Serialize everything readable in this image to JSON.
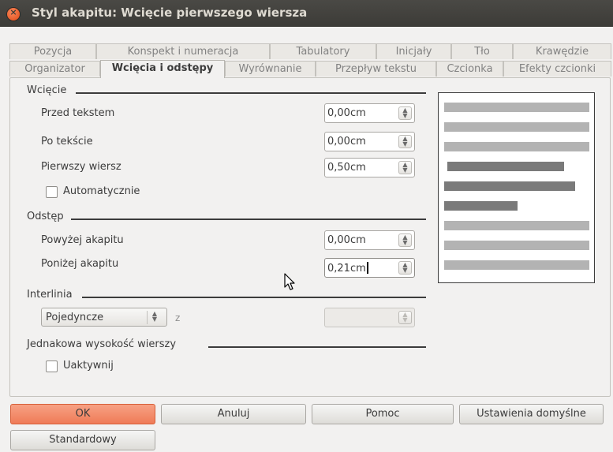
{
  "window": {
    "title": "Styl akapitu: Wcięcie pierwszego wiersza"
  },
  "tabs": {
    "row1": [
      "Pozycja",
      "Konspekt i numeracja",
      "Tabulatory",
      "Inicjały",
      "Tło",
      "Krawędzie"
    ],
    "row2": [
      "Organizator",
      "Wcięcia i odstępy",
      "Wyrównanie",
      "Przepływ tekstu",
      "Czcionka",
      "Efekty czcionki"
    ],
    "active": "Wcięcia i odstępy"
  },
  "indent": {
    "section": "Wcięcie",
    "before": {
      "label": "Przed tekstem",
      "value": "0,00cm"
    },
    "after": {
      "label": "Po tekście",
      "value": "0,00cm"
    },
    "first_line": {
      "label": "Pierwszy wiersz",
      "value": "0,50cm"
    },
    "auto": {
      "label": "Automatycznie",
      "checked": false
    }
  },
  "spacing": {
    "section": "Odstęp",
    "above": {
      "label": "Powyżej akapitu",
      "value": "0,00cm"
    },
    "below": {
      "label": "Poniżej akapitu",
      "value": "0,21cm"
    }
  },
  "line_spacing": {
    "section": "Interlinia",
    "selected": "Pojedyncze",
    "of_label": "z",
    "of_value": ""
  },
  "register": {
    "section": "Jednakowa wysokość wierszy",
    "activate": {
      "label": "Uaktywnij",
      "checked": false
    }
  },
  "buttons": {
    "ok": "OK",
    "cancel": "Anuluj",
    "help": "Pomoc",
    "defaults": "Ustawienia domyślne",
    "standard": "Standardowy"
  },
  "icons": {
    "close": "close-icon",
    "pointer": "mouse-pointer-icon"
  },
  "colors": {
    "accent": "#ef7b57",
    "titlebar": "#3c3b37",
    "preview_text": "#7a7a7a",
    "preview_context": "#b3b3b3"
  }
}
